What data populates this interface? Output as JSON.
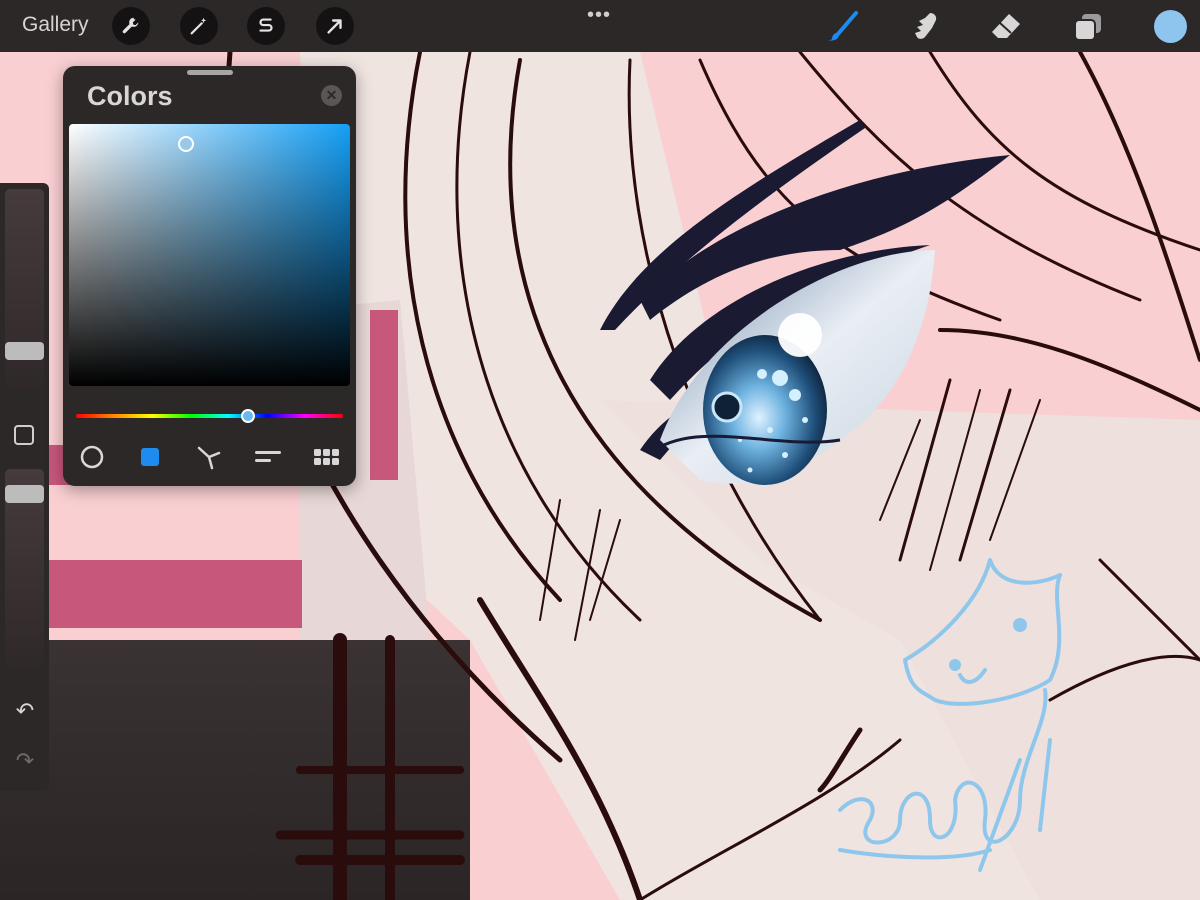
{
  "topbar": {
    "gallery_label": "Gallery",
    "left_tools": [
      "wrench-icon",
      "magic-wand-icon",
      "selection-icon",
      "transform-arrow-icon"
    ],
    "more_label": "•••",
    "right_tools": [
      "brush-icon",
      "smudge-icon",
      "eraser-icon",
      "layers-icon"
    ],
    "current_color": "#8ec5ee",
    "brush_active_color": "#1e8bf0"
  },
  "sidebar": {
    "brush_size_level": 0.68,
    "opacity_level": 0.1,
    "undo_label": "↶",
    "redo_label": "↷"
  },
  "colors_panel": {
    "title": "Colors",
    "close_label": "✕",
    "hue_color": "#149ff6",
    "tabs": [
      "disc-icon",
      "classic-icon",
      "harmony-icon",
      "value-icon",
      "palettes-icon"
    ],
    "active_tab": "classic-icon"
  }
}
